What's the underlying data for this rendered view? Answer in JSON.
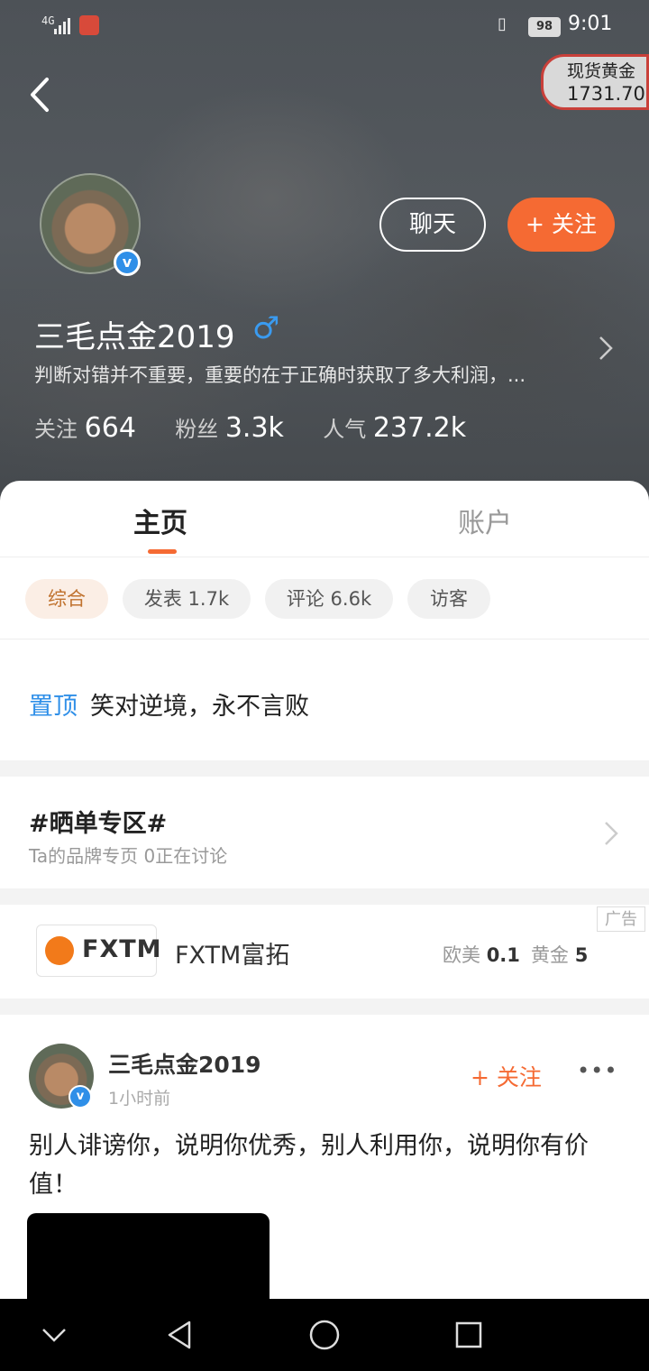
{
  "status_bar": {
    "network": "4G",
    "battery": "98",
    "time": "9:01"
  },
  "header": {
    "ticker": {
      "name": "现货黄金",
      "price": "1731.70"
    },
    "chat_label": "聊天",
    "follow_label": "+ 关注",
    "username": "三毛点金2019",
    "gender_symbol": "♂",
    "bio": "判断对错并不重要，重要的在于正确时获取了多大利润，...",
    "stats": {
      "following_label": "关注",
      "following_value": "664",
      "fans_label": "粉丝",
      "fans_value": "3.3k",
      "popularity_label": "人气",
      "popularity_value": "237.2k"
    }
  },
  "tabs": {
    "home": "主页",
    "account": "账户"
  },
  "filters": [
    "综合",
    "发表 1.7k",
    "评论 6.6k",
    "访客"
  ],
  "pinned": {
    "tag": "置顶",
    "text": "笑对逆境，永不言败"
  },
  "topic": {
    "title": "#晒单专区#",
    "subtitle": "Ta的品牌专页  0正在讨论"
  },
  "ad": {
    "badge": "广告",
    "logo_text": "FXTM",
    "name": "FXTM富拓",
    "eu_label": "欧美",
    "eu_value": "0.1",
    "gold_label": "黄金",
    "gold_value": "5"
  },
  "post": {
    "author": "三毛点金2019",
    "time": "1小时前",
    "follow_label": "+ 关注",
    "more": "•••",
    "text": "别人诽谤你，说明你优秀，别人利用你，说明你有价值！"
  },
  "icons": {
    "back": "chevron-left-icon",
    "verified": "verified-badge-icon",
    "nav": [
      "chevron-down-icon",
      "back-triangle-icon",
      "home-circle-icon",
      "recents-square-icon"
    ]
  },
  "colors": {
    "accent": "#f56a33",
    "link_blue": "#2f8fe8"
  }
}
